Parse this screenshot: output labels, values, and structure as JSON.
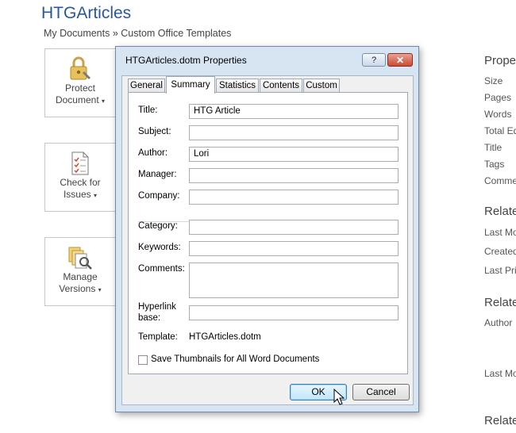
{
  "backstage": {
    "title": "HTGArticles",
    "breadcrumb": "My Documents » Custom Office Templates",
    "buttons": [
      {
        "label1": "Protect",
        "label2": "Document",
        "icon": "lock-icon"
      },
      {
        "label1": "Check for",
        "label2": "Issues",
        "icon": "checklist-icon"
      },
      {
        "label1": "Manage",
        "label2": "Versions",
        "icon": "versions-icon"
      }
    ],
    "right": {
      "properties_head": "Prope",
      "properties_items": [
        "Size",
        "Pages",
        "Words",
        "Total Ed",
        "Title",
        "Tags",
        "Comme"
      ],
      "related_head": "Relate",
      "related_items": [
        "Last Mo",
        "Created",
        "Last Pri"
      ],
      "related_people_head": "Relate",
      "related_people_items": [
        "Author"
      ],
      "last_mod": "Last Mo",
      "related_docs_head": "Relate"
    }
  },
  "dialog": {
    "title": "HTGArticles.dotm Properties",
    "help_label": "?",
    "close_label": "✕",
    "tabs": [
      "General",
      "Summary",
      "Statistics",
      "Contents",
      "Custom"
    ],
    "active_tab": "Summary",
    "fields": {
      "title": {
        "label": "Title:",
        "value": "HTG Article"
      },
      "subject": {
        "label": "Subject:",
        "value": ""
      },
      "author": {
        "label": "Author:",
        "value": "Lori"
      },
      "manager": {
        "label": "Manager:",
        "value": ""
      },
      "company": {
        "label": "Company:",
        "value": ""
      },
      "category": {
        "label": "Category:",
        "value": ""
      },
      "keywords": {
        "label": "Keywords:",
        "value": ""
      },
      "comments": {
        "label": "Comments:",
        "value": ""
      },
      "hyperlink_base": {
        "label1": "Hyperlink",
        "label2": "base:",
        "value": ""
      }
    },
    "template": {
      "label": "Template:",
      "value": "HTGArticles.dotm"
    },
    "save_thumbnails": {
      "label": "Save Thumbnails for All Word Documents",
      "checked": false
    },
    "ok_label": "OK",
    "cancel_label": "Cancel"
  },
  "colors": {
    "accent": "#2b579a",
    "dialog_frame": "#d7e4f2",
    "close_red": "#c94a35"
  }
}
